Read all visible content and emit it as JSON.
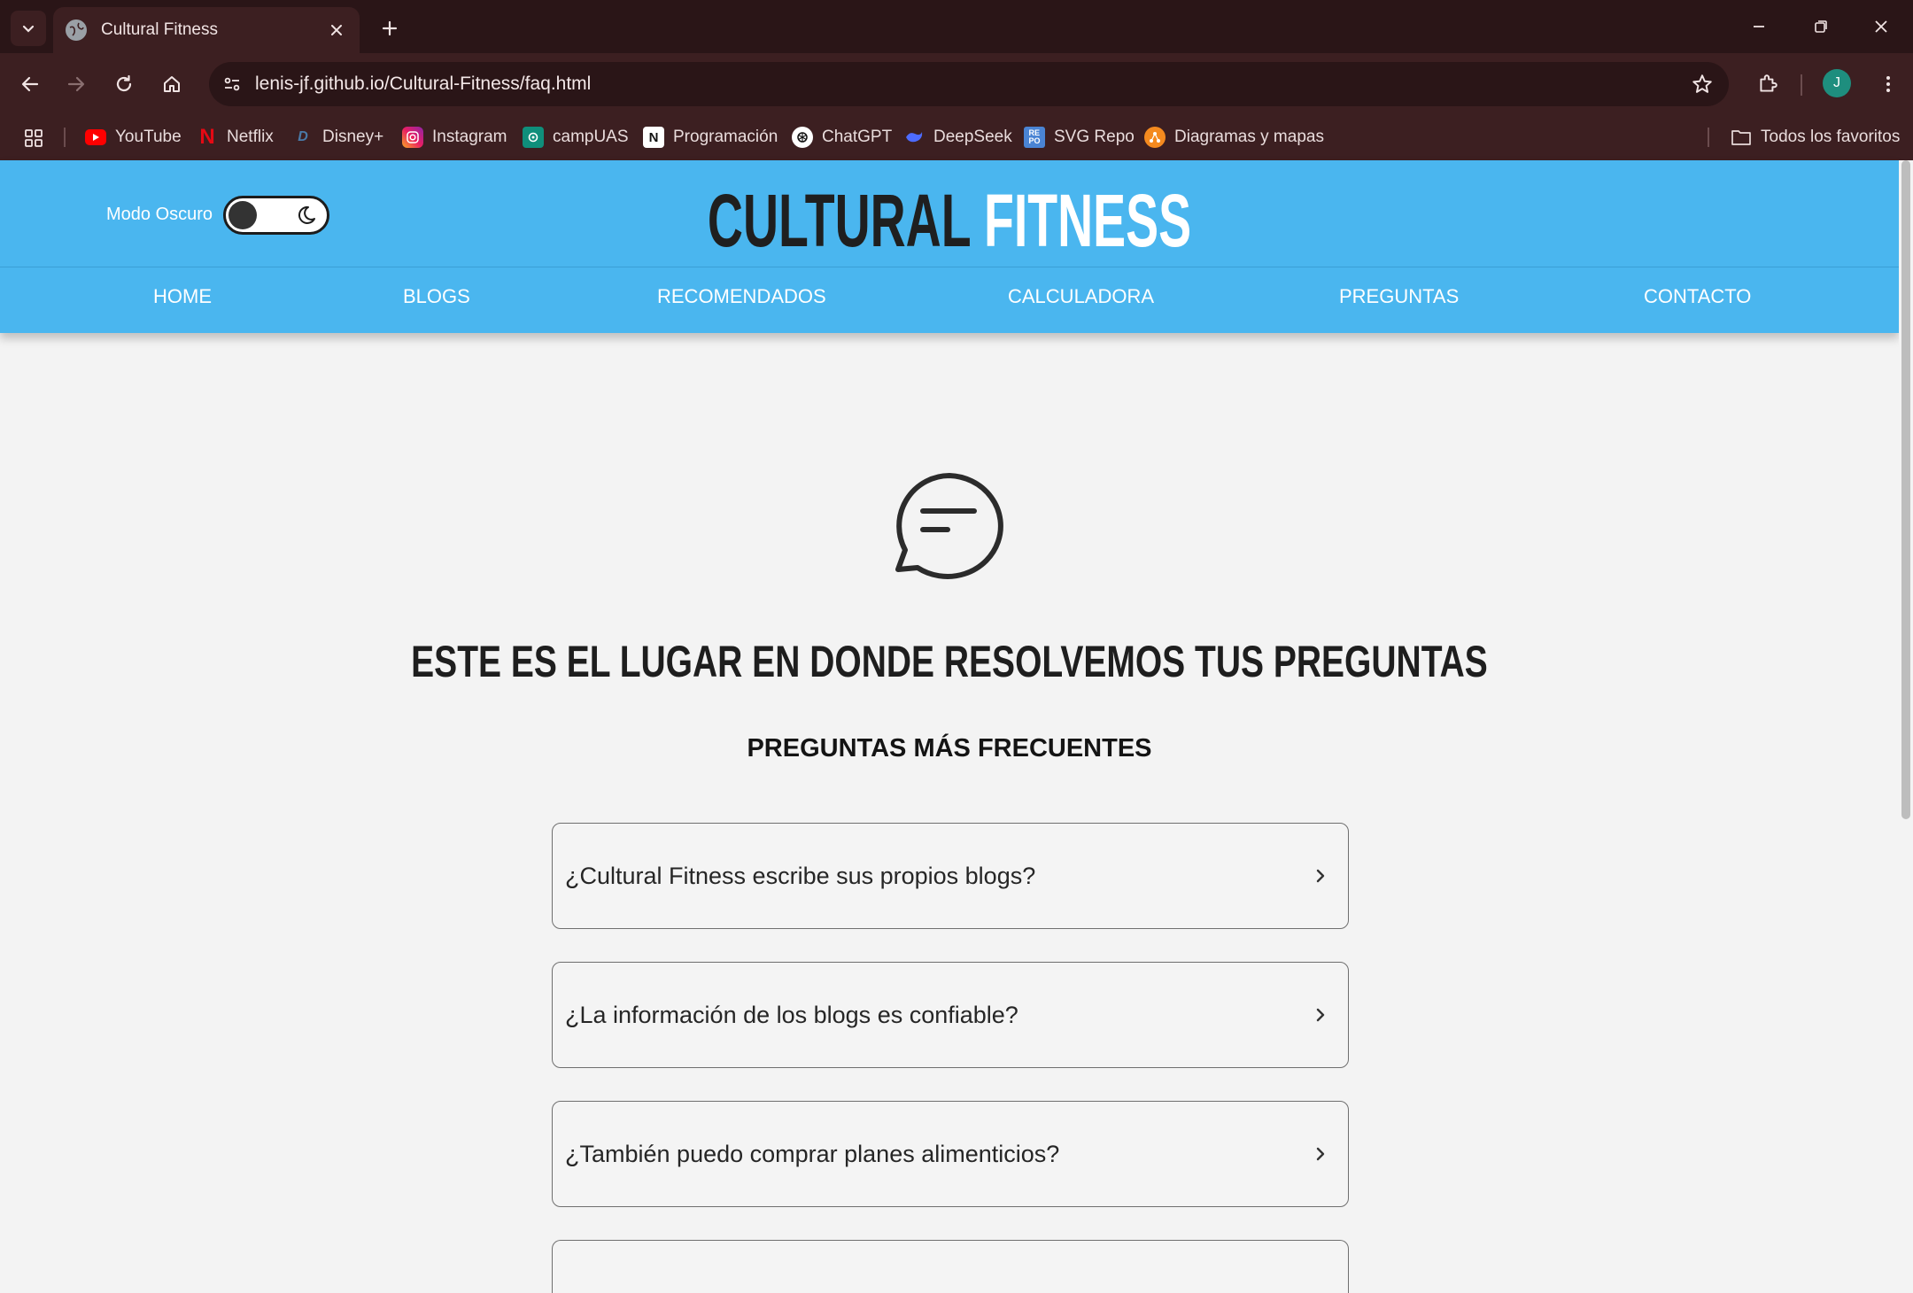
{
  "browser": {
    "tab_title": "Cultural Fitness",
    "url": "lenis-jf.github.io/Cultural-Fitness/faq.html",
    "profile_initial": "J",
    "bookmarks": [
      {
        "label": "YouTube",
        "icon": "youtube-icon",
        "color": "#ff0000"
      },
      {
        "label": "Netflix",
        "icon": "netflix-icon",
        "color": "#e50914"
      },
      {
        "label": "Disney+",
        "icon": "disney-icon",
        "color": "#1a3b5c"
      },
      {
        "label": "Instagram",
        "icon": "instagram-icon",
        "color": "#d62976"
      },
      {
        "label": "campUAS",
        "icon": "campuas-icon",
        "color": "#0f8f7b"
      },
      {
        "label": "Programación",
        "icon": "notion-icon",
        "color": "#ffffff"
      },
      {
        "label": "ChatGPT",
        "icon": "chatgpt-icon",
        "color": "#ffffff"
      },
      {
        "label": "DeepSeek",
        "icon": "deepseek-icon",
        "color": "#4d6bfe"
      },
      {
        "label": "SVG Repo",
        "icon": "svgrepo-icon",
        "color": "#4a84d4"
      },
      {
        "label": "Diagramas y mapas",
        "icon": "diagram-icon",
        "color": "#f48a1f"
      }
    ],
    "all_bookmarks": "Todos los favoritos"
  },
  "site": {
    "dark_mode_label": "Modo Oscuro",
    "dark_mode_on": false,
    "brand_part1": "CULTURAL",
    "brand_part2": "FITNESS",
    "nav": [
      "HOME",
      "BLOGS",
      "RECOMENDADOS",
      "CALCULADORA",
      "PREGUNTAS",
      "CONTACTO"
    ],
    "hero_title": "ESTE ES EL LUGAR EN DONDE RESOLVEMOS TUS PREGUNTAS",
    "subheading": "PREGUNTAS MÁS FRECUENTES",
    "faqs": [
      "¿Cultural Fitness escribe sus propios blogs?",
      "¿La información de los blogs es confiable?",
      "¿También puedo comprar planes alimenticios?",
      ""
    ]
  },
  "colors": {
    "header_bg": "#4ab6ef",
    "page_bg": "#f3f3f3",
    "chrome_bg": "#3c1f21"
  }
}
